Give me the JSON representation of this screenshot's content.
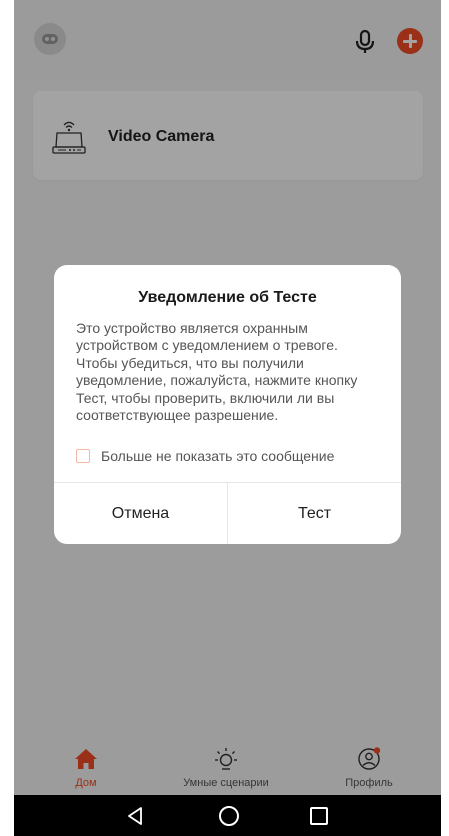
{
  "header": {
    "avatar_icon": "robot-avatar-icon",
    "mic_icon": "microphone-icon",
    "add_icon": "add-device-icon",
    "accent_color": "#f04c24"
  },
  "devices": [
    {
      "name": "Video Camera",
      "icon": "camera-icon"
    }
  ],
  "dialog": {
    "title": "Уведомление об Тесте",
    "message": "Это устройство является охранным устройством с уведомлением о тревоге. Чтобы убедиться, что вы получили уведомление, пожалуйста, нажмите кнопку Тест, чтобы проверить, включили ли вы соответствующее разрешение.",
    "dont_show_label": "Больше не показать это сообщение",
    "dont_show_checked": false,
    "cancel_label": "Отмена",
    "test_label": "Тест"
  },
  "bottom_nav": {
    "items": [
      {
        "label": "Дом",
        "icon": "home-icon",
        "active": true
      },
      {
        "label": "Умные сценарии",
        "icon": "smart-scenes-icon",
        "active": false
      },
      {
        "label": "Профиль",
        "icon": "profile-icon",
        "active": false,
        "badge": true
      }
    ]
  },
  "system_nav": {
    "back_icon": "back-icon",
    "home_icon": "home-circle-icon",
    "recent_icon": "recent-apps-icon"
  }
}
